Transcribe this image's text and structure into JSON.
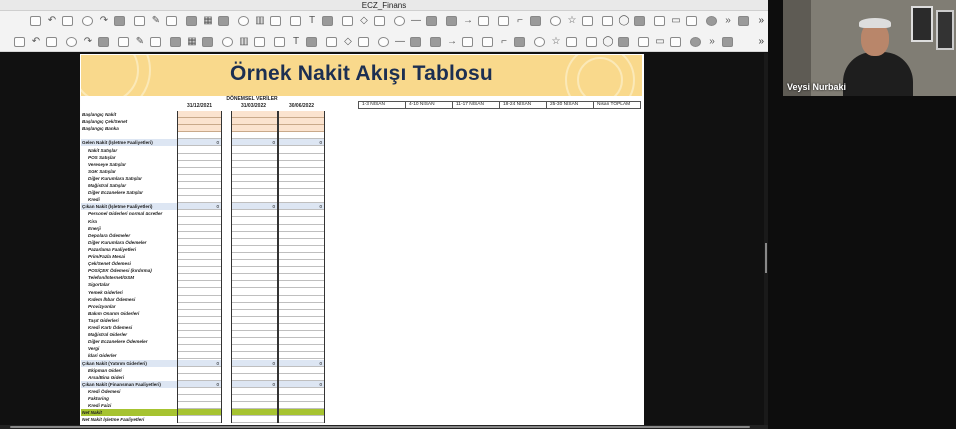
{
  "window": {
    "title": "ECZ_Finans"
  },
  "document": {
    "title": "Örnek Nakit Akışı Tablosu",
    "period_header": "DÖNEMSEL VERİLER",
    "date_columns": [
      "31/12/2021",
      "31/03/2022",
      "30/06/2022"
    ],
    "week_columns": [
      "1-3  NİSAN",
      "4-10 NİSAN",
      "11-17  NİSAN",
      "18-24 NİSAN",
      "25-30 NİSAN",
      "Nisan TOPLAM"
    ],
    "rows": [
      {
        "label": "Başlangıç Nakit",
        "type": "start",
        "values": [
          "",
          "",
          ""
        ]
      },
      {
        "label": "Başlangıç Çek/Senet",
        "type": "start",
        "values": [
          "",
          "",
          ""
        ]
      },
      {
        "label": "Başlangıç Banka",
        "type": "start",
        "values": [
          "",
          "",
          ""
        ]
      },
      {
        "label": "",
        "type": "blank",
        "values": [
          "",
          "",
          ""
        ]
      },
      {
        "label": "Gelen Nakit (İşletme Faaliyetleri)",
        "type": "section",
        "values": [
          "0",
          "0",
          "0"
        ]
      },
      {
        "label": "Nakit Satışlar",
        "type": "item",
        "values": [
          "",
          "",
          ""
        ]
      },
      {
        "label": "POS Satışlar",
        "type": "item",
        "values": [
          "",
          "",
          ""
        ]
      },
      {
        "label": "Vereseye Satışlar",
        "type": "item",
        "values": [
          "",
          "",
          ""
        ]
      },
      {
        "label": "SGK Satışlar",
        "type": "item",
        "values": [
          "",
          "",
          ""
        ]
      },
      {
        "label": "Diğer Kurumlara Satışlar",
        "type": "item",
        "values": [
          "",
          "",
          ""
        ]
      },
      {
        "label": "Mağistral Satışlar",
        "type": "item",
        "values": [
          "",
          "",
          ""
        ]
      },
      {
        "label": "Diğer Eczanelere Satışlar",
        "type": "item",
        "values": [
          "",
          "",
          ""
        ]
      },
      {
        "label": "Kredi",
        "type": "item",
        "values": [
          "",
          "",
          ""
        ]
      },
      {
        "label": "Çıkan Nakit (İşletme Faaliyetleri)",
        "type": "section",
        "values": [
          "0",
          "0",
          "0"
        ]
      },
      {
        "label": "Personel Giderleri normal ücretler",
        "type": "item",
        "values": [
          "",
          "",
          ""
        ]
      },
      {
        "label": "Kira",
        "type": "item",
        "values": [
          "",
          "",
          ""
        ]
      },
      {
        "label": "Enerji",
        "type": "item",
        "values": [
          "",
          "",
          ""
        ]
      },
      {
        "label": "Depolara Ödemeler",
        "type": "item",
        "values": [
          "",
          "",
          ""
        ]
      },
      {
        "label": "Diğer Kurumlara Ödemeler",
        "type": "item",
        "values": [
          "",
          "",
          ""
        ]
      },
      {
        "label": "Pazarlama Faaliyetleri",
        "type": "item",
        "values": [
          "",
          "",
          ""
        ]
      },
      {
        "label": "Prim/Fazla Mesai",
        "type": "item",
        "values": [
          "",
          "",
          ""
        ]
      },
      {
        "label": "Çek/Senet Ödemesi",
        "type": "item",
        "values": [
          "",
          "",
          ""
        ]
      },
      {
        "label": "POS/ÇEK Ödemesi (kırdırma)",
        "type": "item",
        "values": [
          "",
          "",
          ""
        ]
      },
      {
        "label": "Telefon/İnternet/GSM",
        "type": "item",
        "values": [
          "",
          "",
          ""
        ]
      },
      {
        "label": "Sigortalar",
        "type": "item",
        "values": [
          "",
          "",
          ""
        ]
      },
      {
        "label": "Yemek Giderleri",
        "type": "item",
        "values": [
          "",
          "",
          ""
        ]
      },
      {
        "label": "Kıdem İhbar Ödemesi",
        "type": "item",
        "values": [
          "",
          "",
          ""
        ]
      },
      {
        "label": "Provizyonlar",
        "type": "item",
        "values": [
          "",
          "",
          ""
        ]
      },
      {
        "label": "Bakım Onarım Giderleri",
        "type": "item",
        "values": [
          "",
          "",
          ""
        ]
      },
      {
        "label": "Taşıt Giderleri",
        "type": "item",
        "values": [
          "",
          "",
          ""
        ]
      },
      {
        "label": "Kredi Kartı Ödemesi",
        "type": "item",
        "values": [
          "",
          "",
          ""
        ]
      },
      {
        "label": "Mağistral Giderler",
        "type": "item",
        "values": [
          "",
          "",
          ""
        ]
      },
      {
        "label": "Diğer Eczanelere Ödemeler",
        "type": "item",
        "values": [
          "",
          "",
          ""
        ]
      },
      {
        "label": "Vergi",
        "type": "item",
        "values": [
          "",
          "",
          ""
        ]
      },
      {
        "label": "İdari Giderler",
        "type": "item",
        "values": [
          "",
          "",
          ""
        ]
      },
      {
        "label": "Çıkan Nakit (Yatırım Giderleri)",
        "type": "section",
        "values": [
          "0",
          "0",
          "0"
        ]
      },
      {
        "label": "Ekipman Gideri",
        "type": "item",
        "values": [
          "",
          "",
          ""
        ]
      },
      {
        "label": "Arsa/Bina Gideri",
        "type": "item",
        "values": [
          "",
          "",
          ""
        ]
      },
      {
        "label": "Çıkan Nakit (Finansman Faaliyetleri)",
        "type": "section",
        "values": [
          "0",
          "0",
          "0"
        ]
      },
      {
        "label": "Kredi Ödemesi",
        "type": "item",
        "values": [
          "",
          "",
          ""
        ]
      },
      {
        "label": "Faktoring",
        "type": "item",
        "values": [
          "",
          "",
          ""
        ]
      },
      {
        "label": "Kredi Faizi",
        "type": "item",
        "values": [
          "",
          "",
          ""
        ]
      },
      {
        "label": "Net Nakit",
        "type": "net",
        "values": [
          "",
          "",
          ""
        ]
      },
      {
        "label": "Net Nakit İşletme Faaliyetleri",
        "type": "item_flat",
        "values": [
          "",
          "",
          ""
        ]
      }
    ]
  },
  "participant": {
    "name": "Veysi Nurbaki"
  },
  "colors": {
    "banner": "#f9d98c",
    "title_text": "#1c2f52",
    "start_fill": "#fbe3cf",
    "section_fill": "#dde6f3",
    "net_fill": "#a6c330"
  },
  "toolbar": {
    "row1_icons": [
      "undo-icon",
      "redo-icon",
      "paint-icon",
      "table-icon",
      "chart-icon",
      "text-icon",
      "shapes-icon",
      "line-icon",
      "arrow-icon",
      "connector-icon",
      "star-icon",
      "callout-icon",
      "flowchart-icon",
      "more-icon"
    ],
    "row2_icons": [
      "fill-icon",
      "line-color-icon",
      "rect-icon",
      "ellipse-icon",
      "arrow-icon",
      "curve-icon",
      "polygon-icon",
      "crop-icon",
      "align-icon",
      "distribute-icon",
      "group-icon",
      "rotate-icon",
      "flip-icon",
      "more-icon"
    ]
  }
}
